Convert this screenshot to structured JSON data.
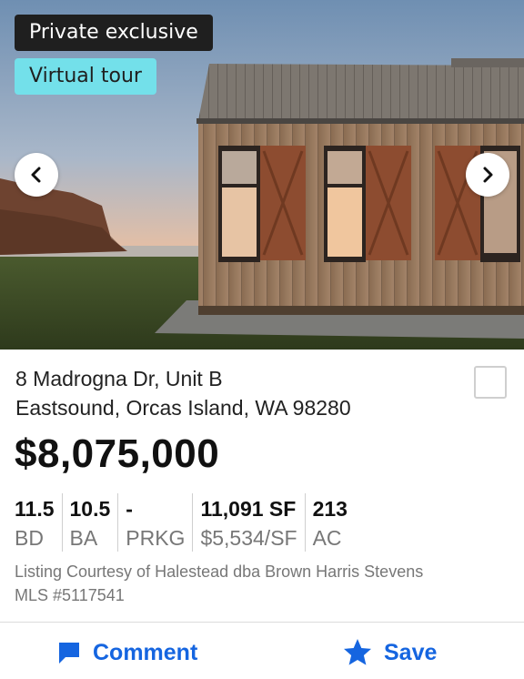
{
  "badges": {
    "private": "Private exclusive",
    "virtual": "Virtual tour"
  },
  "icons": {
    "prev": "chevron-left-icon",
    "next": "chevron-right-icon",
    "comment": "comment-icon",
    "save": "star-icon"
  },
  "listing": {
    "address_line1": "8 Madrogna Dr, Unit B",
    "address_line2": "Eastsound, Orcas Island, WA 98280",
    "price": "$8,075,000",
    "stats": [
      {
        "value": "11.5",
        "label": "BD"
      },
      {
        "value": "10.5",
        "label": "BA"
      },
      {
        "value": "-",
        "label": "PRKG"
      },
      {
        "value": "11,091 SF",
        "label": "$5,534/SF"
      },
      {
        "value": "213",
        "label": "AC"
      }
    ],
    "courtesy": "Listing Courtesy of Halestead dba Brown Harris Stevens MLS #5117541"
  },
  "actions": {
    "comment": "Comment",
    "save": "Save"
  },
  "colors": {
    "accent": "#1565e0",
    "badge_private_bg": "#1f1f1f",
    "badge_virtual_bg": "#73e0ea"
  }
}
